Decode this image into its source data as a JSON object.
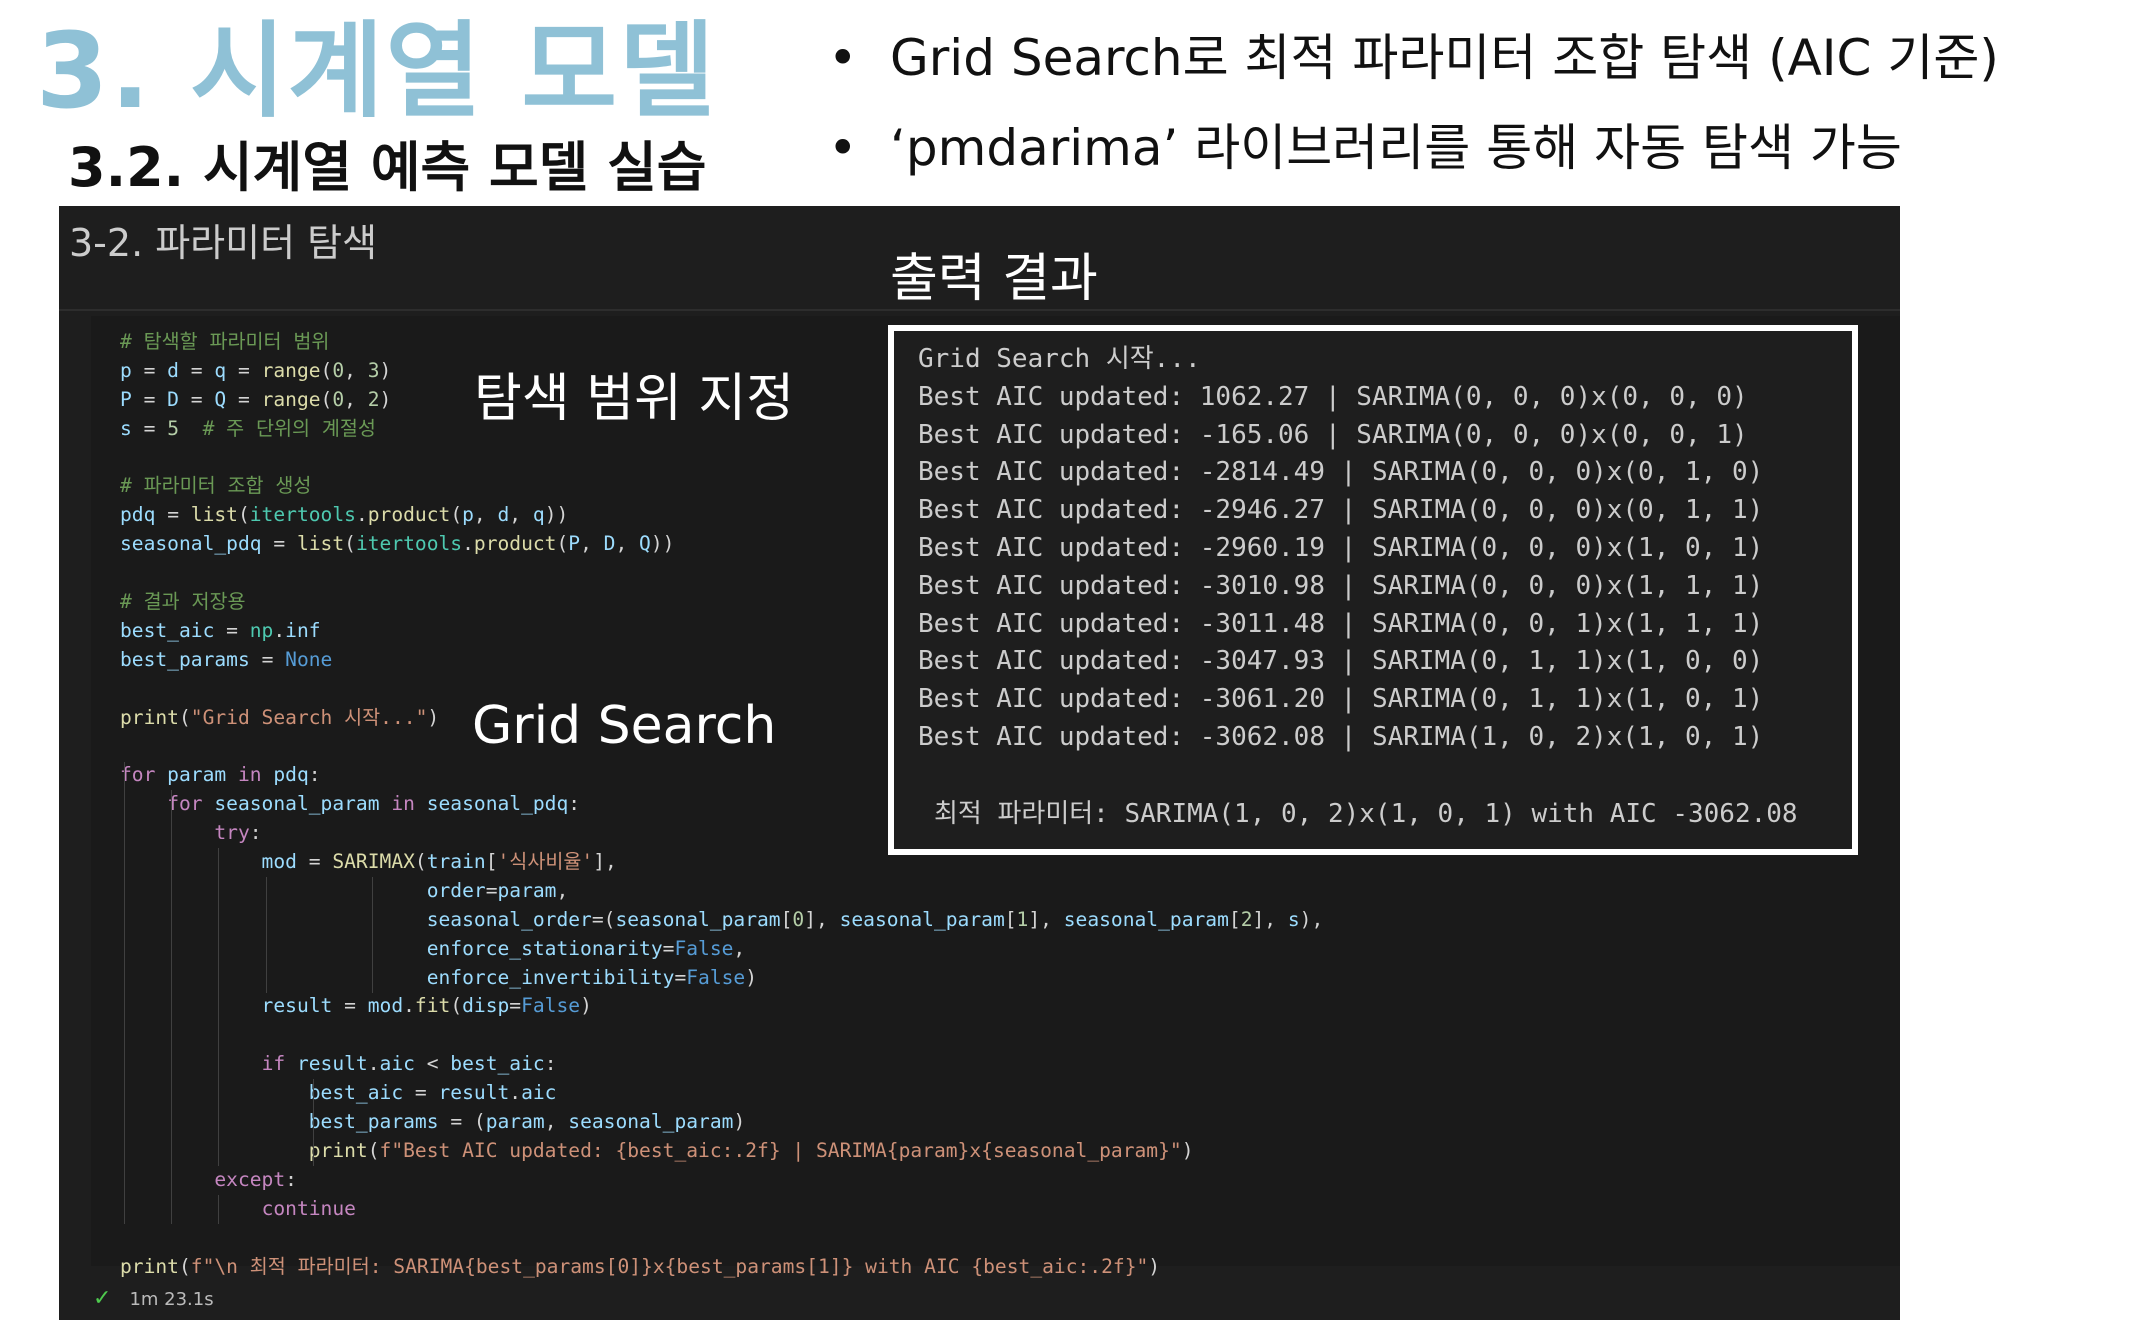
{
  "slide": {
    "title": "3. 시계열 모델",
    "subtitle": "3.2. 시계열 예측 모델 실습",
    "bullets": [
      "Grid Search로 최적 파라미터 조합 탐색 (AIC 기준)",
      "‘pmdarima’ 라이브러리를 통해 자동 탐색 가능"
    ]
  },
  "notebook": {
    "cell_title": "3-2. 파라미터 탐색",
    "status_time": "1m 23.1s",
    "check_icon": "check-icon"
  },
  "annotations": {
    "search_range": "탐색 범위 지정",
    "grid_search": "Grid Search",
    "output_result": "출력 결과"
  },
  "code": {
    "lines": [
      "# 탐색할 파라미터 범위",
      "p = d = q = range(0, 3)",
      "P = D = Q = range(0, 2)",
      "s = 5  # 주 단위의 계절성",
      "",
      "# 파라미터 조합 생성",
      "pdq = list(itertools.product(p, d, q))",
      "seasonal_pdq = list(itertools.product(P, D, Q))",
      "",
      "# 결과 저장용",
      "best_aic = np.inf",
      "best_params = None",
      "",
      "print(\"Grid Search 시작...\")",
      "",
      "for param in pdq:",
      "    for seasonal_param in seasonal_pdq:",
      "        try:",
      "            mod = SARIMAX(train['식사비율'],",
      "                          order=param,",
      "                          seasonal_order=(seasonal_param[0], seasonal_param[1], seasonal_param[2], s),",
      "                          enforce_stationarity=False,",
      "                          enforce_invertibility=False)",
      "            result = mod.fit(disp=False)",
      "",
      "            if result.aic < best_aic:",
      "                best_aic = result.aic",
      "                best_params = (param, seasonal_param)",
      "                print(f\"Best AIC updated: {best_aic:.2f} | SARIMA{param}x{seasonal_param}\")",
      "        except:",
      "            continue",
      "",
      "print(f\"\\n 최적 파라미터: SARIMA{best_params[0]}x{best_params[1]} with AIC {best_aic:.2f}\")"
    ]
  },
  "output": {
    "lines": [
      "Grid Search 시작...",
      "Best AIC updated: 1062.27 | SARIMA(0, 0, 0)x(0, 0, 0)",
      "Best AIC updated: -165.06 | SARIMA(0, 0, 0)x(0, 0, 1)",
      "Best AIC updated: -2814.49 | SARIMA(0, 0, 0)x(0, 1, 0)",
      "Best AIC updated: -2946.27 | SARIMA(0, 0, 0)x(0, 1, 1)",
      "Best AIC updated: -2960.19 | SARIMA(0, 0, 0)x(1, 0, 1)",
      "Best AIC updated: -3010.98 | SARIMA(0, 0, 0)x(1, 1, 1)",
      "Best AIC updated: -3011.48 | SARIMA(0, 0, 1)x(1, 1, 1)",
      "Best AIC updated: -3047.93 | SARIMA(0, 1, 1)x(1, 0, 0)",
      "Best AIC updated: -3061.20 | SARIMA(0, 1, 1)x(1, 0, 1)",
      "Best AIC updated: -3062.08 | SARIMA(1, 0, 2)x(1, 0, 1)"
    ],
    "final": "최적 파라미터: SARIMA(1, 0, 2)x(1, 0, 1) with AIC -3062.08"
  }
}
